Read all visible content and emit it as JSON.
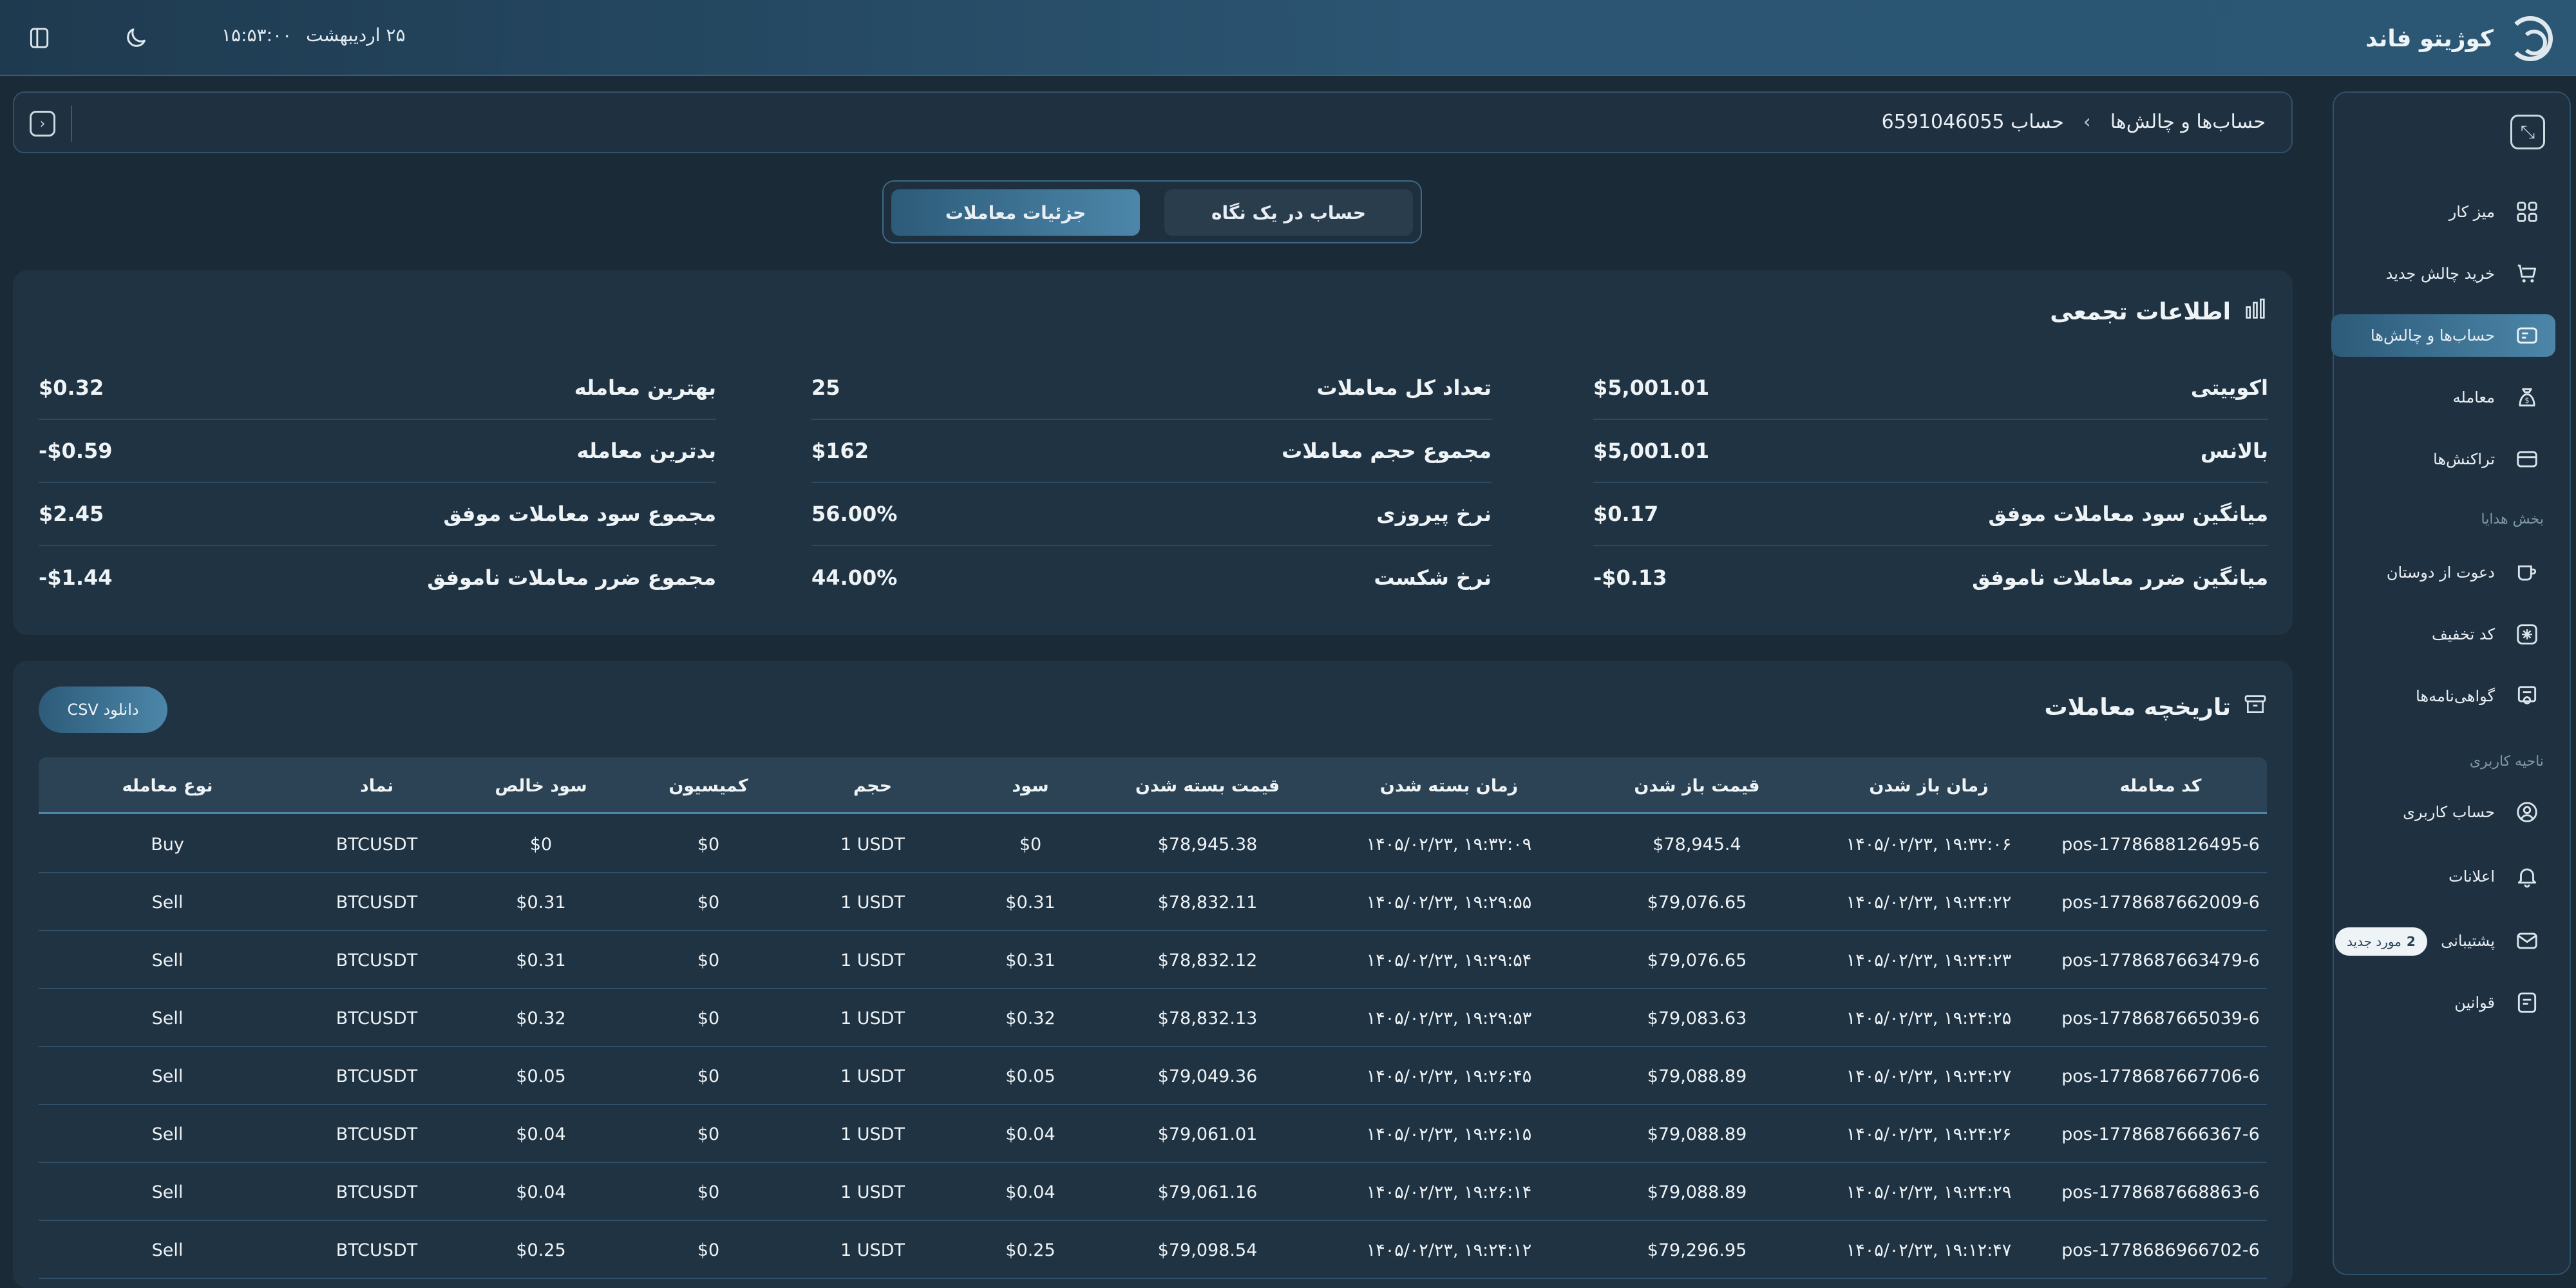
{
  "header": {
    "brand": "کوژیتو فاند",
    "time": "۱۵:۵۳:۰۰",
    "date": "۲۵ اردیبهشت"
  },
  "sidebar": {
    "items": [
      {
        "label": "میز کار",
        "icon": "dashboard-icon",
        "active": false
      },
      {
        "label": "خرید چالش جدید",
        "icon": "cart-icon",
        "active": false
      },
      {
        "label": "حساب‌ها و چالش‌ها",
        "icon": "accounts-icon",
        "active": true
      },
      {
        "label": "معامله",
        "icon": "trade-icon",
        "active": false
      },
      {
        "label": "تراکنش‌ها",
        "icon": "transactions-icon",
        "active": false
      }
    ],
    "gifts_section": "بخش هدایا",
    "gift_items": [
      {
        "label": "دعوت از دوستان",
        "icon": "invite-icon"
      },
      {
        "label": "کد تخفیف",
        "icon": "discount-icon"
      },
      {
        "label": "گواهی‌نامه‌ها",
        "icon": "certificate-icon"
      }
    ],
    "user_section": "ناحیه کاربری",
    "user_items": [
      {
        "label": "حساب کاربری",
        "icon": "user-icon"
      },
      {
        "label": "اعلانات",
        "icon": "bell-icon"
      },
      {
        "label": "پشتیبانی",
        "icon": "mail-icon",
        "badge_count": "2",
        "badge_text": "مورد جدید"
      },
      {
        "label": "قوانین",
        "icon": "rules-icon"
      }
    ]
  },
  "breadcrumb": {
    "root": "حساب‌ها و چالش‌ها",
    "current": "حساب 6591046055"
  },
  "tabs": {
    "details": "جزئیات معاملات",
    "overview": "حساب در یک نگاه"
  },
  "summary": {
    "title": "اطلاعات تجمعی",
    "columns": [
      [
        {
          "label": "اکوییتی",
          "value": "$5,001.01"
        },
        {
          "label": "بالانس",
          "value": "$5,001.01"
        },
        {
          "label": "میانگین سود معاملات موفق",
          "value": "$0.17"
        },
        {
          "label": "میانگین ضرر معاملات ناموفق",
          "value": "-$0.13"
        }
      ],
      [
        {
          "label": "تعداد کل معاملات",
          "value": "25"
        },
        {
          "label": "مجموع حجم معاملات",
          "value": "$162"
        },
        {
          "label": "نرخ پیروزی",
          "value": "56.00%"
        },
        {
          "label": "نرخ شکست",
          "value": "44.00%"
        }
      ],
      [
        {
          "label": "بهترین معامله",
          "value": "$0.32"
        },
        {
          "label": "بدترین معامله",
          "value": "-$0.59"
        },
        {
          "label": "مجموع سود معاملات موفق",
          "value": "$2.45"
        },
        {
          "label": "مجموع ضرر معاملات ناموفق",
          "value": "-$1.44"
        }
      ]
    ]
  },
  "history": {
    "title": "تاریخچه معاملات",
    "csv_button": "دانلود CSV",
    "headers": [
      "کد معامله",
      "زمان باز شدن",
      "قیمت باز شدن",
      "زمان بسته شدن",
      "قیمت بسته شدن",
      "سود",
      "حجم",
      "کمیسیون",
      "سود خالص",
      "نماد",
      "نوع معامله"
    ],
    "rows": [
      [
        "pos-1778688126495-6",
        "۱۴۰۵/۰۲/۲۳, ۱۹:۳۲:۰۶",
        "$78,945.4",
        "۱۴۰۵/۰۲/۲۳, ۱۹:۳۲:۰۹",
        "$78,945.38",
        "$0",
        "1 USDT",
        "$0",
        "$0",
        "BTCUSDT",
        "Buy"
      ],
      [
        "pos-1778687662009-6",
        "۱۴۰۵/۰۲/۲۳, ۱۹:۲۴:۲۲",
        "$79,076.65",
        "۱۴۰۵/۰۲/۲۳, ۱۹:۲۹:۵۵",
        "$78,832.11",
        "$0.31",
        "1 USDT",
        "$0",
        "$0.31",
        "BTCUSDT",
        "Sell"
      ],
      [
        "pos-1778687663479-6",
        "۱۴۰۵/۰۲/۲۳, ۱۹:۲۴:۲۳",
        "$79,076.65",
        "۱۴۰۵/۰۲/۲۳, ۱۹:۲۹:۵۴",
        "$78,832.12",
        "$0.31",
        "1 USDT",
        "$0",
        "$0.31",
        "BTCUSDT",
        "Sell"
      ],
      [
        "pos-1778687665039-6",
        "۱۴۰۵/۰۲/۲۳, ۱۹:۲۴:۲۵",
        "$79,083.63",
        "۱۴۰۵/۰۲/۲۳, ۱۹:۲۹:۵۳",
        "$78,832.13",
        "$0.32",
        "1 USDT",
        "$0",
        "$0.32",
        "BTCUSDT",
        "Sell"
      ],
      [
        "pos-1778687667706-6",
        "۱۴۰۵/۰۲/۲۳, ۱۹:۲۴:۲۷",
        "$79,088.89",
        "۱۴۰۵/۰۲/۲۳, ۱۹:۲۶:۴۵",
        "$79,049.36",
        "$0.05",
        "1 USDT",
        "$0",
        "$0.05",
        "BTCUSDT",
        "Sell"
      ],
      [
        "pos-1778687666367-6",
        "۱۴۰۵/۰۲/۲۳, ۱۹:۲۴:۲۶",
        "$79,088.89",
        "۱۴۰۵/۰۲/۲۳, ۱۹:۲۶:۱۵",
        "$79,061.01",
        "$0.04",
        "1 USDT",
        "$0",
        "$0.04",
        "BTCUSDT",
        "Sell"
      ],
      [
        "pos-1778687668863-6",
        "۱۴۰۵/۰۲/۲۳, ۱۹:۲۴:۲۹",
        "$79,088.89",
        "۱۴۰۵/۰۲/۲۳, ۱۹:۲۶:۱۴",
        "$79,061.16",
        "$0.04",
        "1 USDT",
        "$0",
        "$0.04",
        "BTCUSDT",
        "Sell"
      ],
      [
        "pos-1778686966702-6",
        "۱۴۰۵/۰۲/۲۳, ۱۹:۱۲:۴۷",
        "$79,296.95",
        "۱۴۰۵/۰۲/۲۳, ۱۹:۲۴:۱۲",
        "$79,098.54",
        "$0.25",
        "1 USDT",
        "$0",
        "$0.25",
        "BTCUSDT",
        "Sell"
      ]
    ]
  }
}
